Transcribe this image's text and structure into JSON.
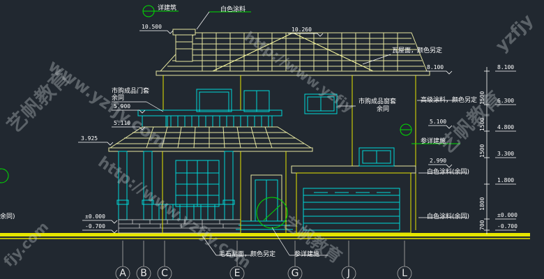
{
  "colors": {
    "background": "#212830",
    "roof": "#e6e6a0",
    "walls": "#e6e600",
    "windows": "#00d8d8",
    "callouts": "#00e000",
    "ground": "#e6e600",
    "leaders": "#ffffff"
  },
  "labels": {
    "detail_top": "详建筑",
    "white_paint_top": "白色涂料",
    "roof_tile": "瓦屋面，颜色另定",
    "door_frame": "市购成品门套",
    "door_frame_sub": "余同",
    "window_frame": "市购成品窗套",
    "window_frame_sub": "余同",
    "high_grade_paint": "高级涂料，颜色另定",
    "detail_mid": "参详建施",
    "white_paint_1": "白色涂料(余同)",
    "white_paint_2": "白色涂料(余同)",
    "rubble_stone": "毛石贴面，颜色另定",
    "detail_bottom": "参详建施",
    "left_edge": "余同)"
  },
  "elevations_left": {
    "e10500": "10.500",
    "e10260": "10.260",
    "e5900": "5.900",
    "e5110": "5.110",
    "e3925": "3.925",
    "e0": "±0.000",
    "em070": "-0.700"
  },
  "elevations_mid": {
    "e8100": "8.100",
    "e5100": "5.100",
    "e2990": "2.990",
    "e0": "±0.000"
  },
  "elevations_right": {
    "e8100": "8.100",
    "e6300": "6.300",
    "e4800": "4.800",
    "e3300": "3.300",
    "e1800": "1.800",
    "e0": "±0.000",
    "em070": "-0.700"
  },
  "dimensions": {
    "d1500a": "1500",
    "d1500b": "1500",
    "d1500c": "1500",
    "d1800": "1800",
    "d700": "700"
  },
  "grid_axes": [
    "A",
    "B",
    "C",
    "E",
    "G",
    "J",
    "L"
  ],
  "watermarks": {
    "w1": "www.yzfjy.com",
    "w2": "http://www.yzfjy.com",
    "w3": "艺帆教育",
    "w4": "艺帆教育",
    "w5": "yzfjy",
    "w6": "fjy.com",
    "w7": "http://www.yzfjy",
    "w8": "艺帆教育"
  }
}
